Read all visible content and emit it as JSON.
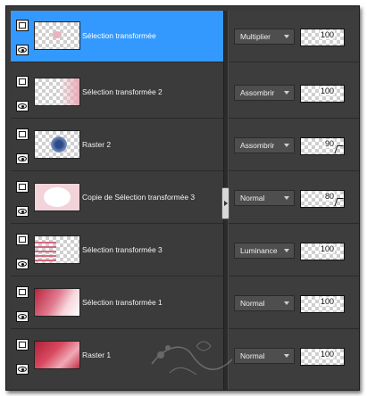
{
  "layers": [
    {
      "name": "Sélection transformée",
      "blend": "Multiplier",
      "opacity": "100",
      "selected": true
    },
    {
      "name": "Sélection transformée 2",
      "blend": "Assombrir",
      "opacity": "100",
      "selected": false
    },
    {
      "name": "Raster 2",
      "blend": "Assombrir",
      "opacity": "90",
      "selected": false
    },
    {
      "name": "Copie de Sélection transformée 3",
      "blend": "Normal",
      "opacity": "80",
      "selected": false
    },
    {
      "name": "Sélection transformée 3",
      "blend": "Luminance",
      "opacity": "100",
      "selected": false
    },
    {
      "name": "Sélection transformée 1",
      "blend": "Normal",
      "opacity": "100",
      "selected": false
    },
    {
      "name": "Raster 1",
      "blend": "Normal",
      "opacity": "100",
      "selected": false
    }
  ],
  "colors": {
    "selection": "#3399ff",
    "panel": "#3b3b3b",
    "accent_red": "#c0304a"
  }
}
